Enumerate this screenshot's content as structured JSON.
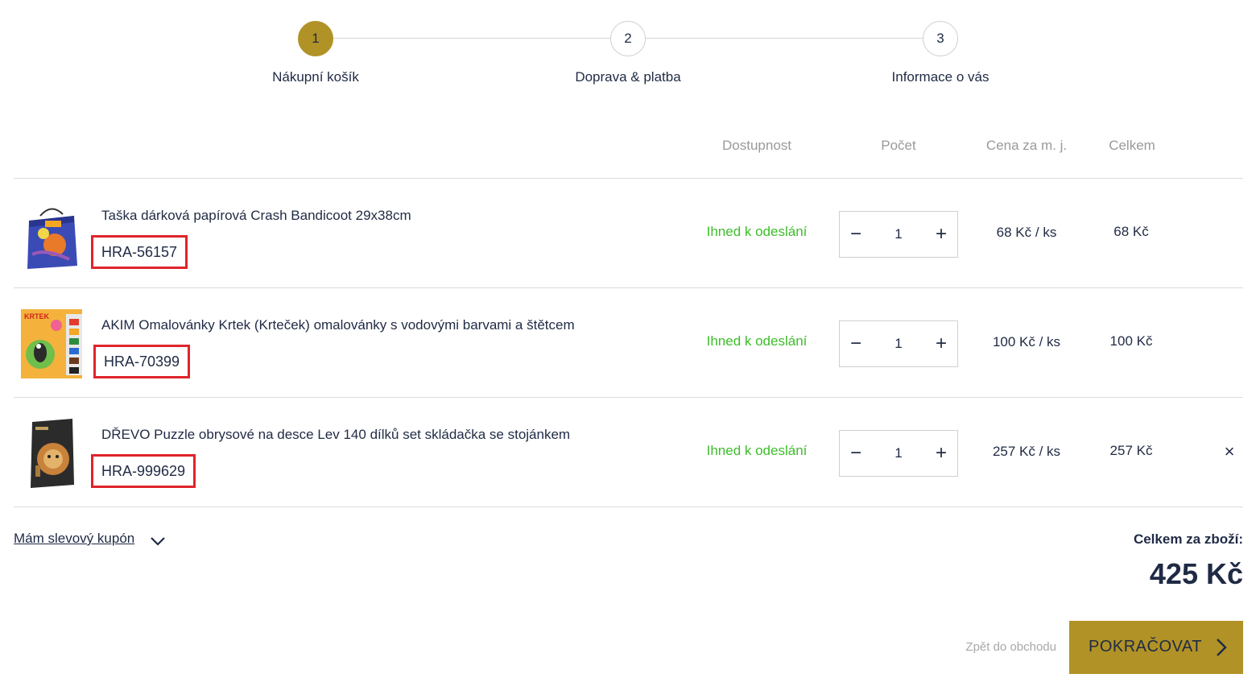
{
  "steps": [
    {
      "number": "1",
      "label": "Nákupní košík"
    },
    {
      "number": "2",
      "label": "Doprava & platba"
    },
    {
      "number": "3",
      "label": "Informace o vás"
    }
  ],
  "table": {
    "headers": {
      "availability": "Dostupnost",
      "quantity": "Počet",
      "unit_price": "Cena za m. j.",
      "total": "Celkem"
    }
  },
  "items": [
    {
      "name": "Taška dárková papírová Crash Bandicoot 29x38cm",
      "sku": "HRA-56157",
      "availability": "Ihned k odeslání",
      "quantity": "1",
      "unit_price": "68 Kč / ks",
      "total": "68 Kč",
      "thumb_icon": "gift-bag-thumbnail"
    },
    {
      "name": "AKIM Omalovánky Krtek (Krteček) omalovánky s vodovými barvami a štětcem",
      "sku": "HRA-70399",
      "availability": "Ihned k odeslání",
      "quantity": "1",
      "unit_price": "100 Kč / ks",
      "total": "100 Kč",
      "thumb_icon": "coloring-book-thumbnail",
      "thumb_text": "KRTEK"
    },
    {
      "name": "DŘEVO Puzzle obrysové na desce Lev 140 dílků set skládačka se stojánkem",
      "sku": "HRA-999629",
      "availability": "Ihned k odeslání",
      "quantity": "1",
      "unit_price": "257 Kč / ks",
      "total": "257 Kč",
      "thumb_icon": "puzzle-box-thumbnail"
    }
  ],
  "controls": {
    "minus": "−",
    "plus": "+",
    "remove": "×"
  },
  "coupon": {
    "label": "Mám slevový kupón"
  },
  "summary": {
    "label": "Celkem za zboží:",
    "value": "425 Kč"
  },
  "actions": {
    "back": "Zpět do obchodu",
    "continue": "POKRAČOVAT"
  },
  "colors": {
    "accent": "#b09226",
    "text": "#1f2a44",
    "availability": "#3dbd2a",
    "highlight_box": "#e0242c",
    "muted": "#9a9a9a"
  }
}
